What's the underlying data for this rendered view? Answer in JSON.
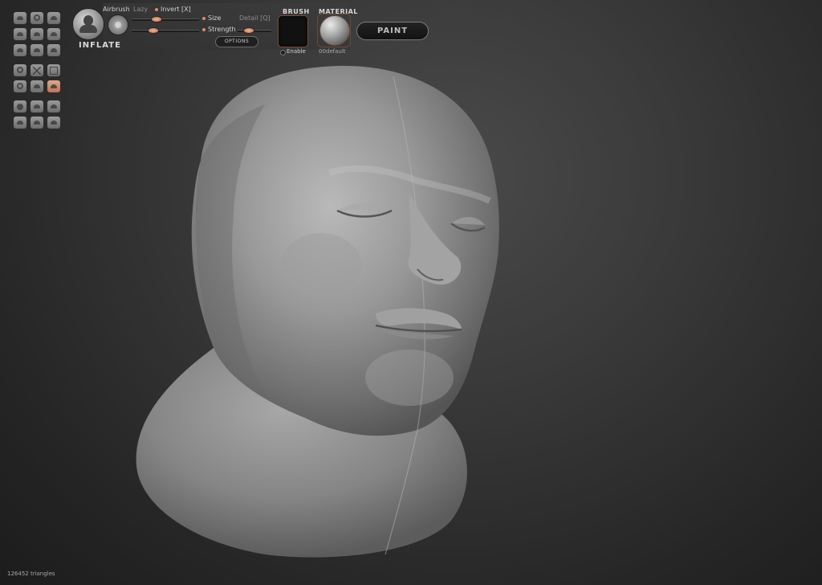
{
  "brush": {
    "name": "INFLATE",
    "airbrush_label": "Airbrush",
    "lazy_label": "Lazy",
    "invert_label": "Invert [X]",
    "size_label": "Size",
    "detail_label": "Detail [Q]",
    "strength_label": "Strength",
    "options_label": "OPTIONS",
    "size_value": 0.5,
    "strength_value": 0.5,
    "detail_value": 0.5
  },
  "brush_panel": {
    "header": "BRUSH",
    "enable_label": "Enable"
  },
  "material_panel": {
    "header": "MATERIAL",
    "name": "00default"
  },
  "paint_button": {
    "label": "PAINT"
  },
  "status": {
    "triangles": "126452 triangles"
  },
  "colors": {
    "accent": "#d98a6a",
    "background": "#333333",
    "model": "#9a9a9a"
  },
  "tools": [
    "inflate-icon",
    "rotate-icon",
    "drag-icon",
    "clay-icon",
    "flatten-icon",
    "pinch-icon",
    "crease-icon",
    "smooth-icon",
    "layer-icon",
    "transform-icon",
    "mask-icon",
    "grid-icon",
    "wireframe-icon",
    "symmetry-icon",
    "mirror-icon",
    "sphere-icon",
    "camera-icon",
    "light-icon",
    "scene-icon",
    "export-icon",
    "help-icon"
  ]
}
